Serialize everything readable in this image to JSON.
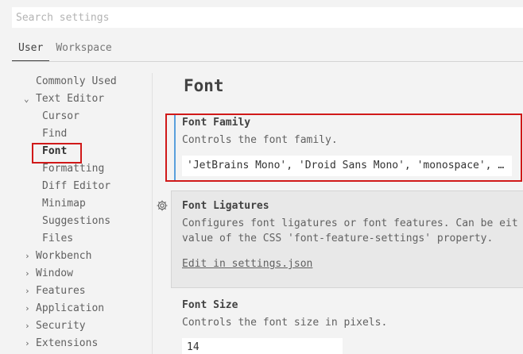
{
  "search": {
    "placeholder": "Search settings"
  },
  "tabs": [
    {
      "label": "User",
      "active": true
    },
    {
      "label": "Workspace",
      "active": false
    }
  ],
  "toc": {
    "items": [
      {
        "label": "Commonly Used",
        "chevron": ""
      },
      {
        "label": "Text Editor",
        "chevron": "chevron-down-icon"
      },
      {
        "label": "Cursor"
      },
      {
        "label": "Find"
      },
      {
        "label": "Font",
        "active": true
      },
      {
        "label": "Formatting"
      },
      {
        "label": "Diff Editor"
      },
      {
        "label": "Minimap"
      },
      {
        "label": "Suggestions"
      },
      {
        "label": "Files"
      },
      {
        "label": "Workbench",
        "chevron": "chevron-right-icon"
      },
      {
        "label": "Window",
        "chevron": "chevron-right-icon"
      },
      {
        "label": "Features",
        "chevron": "chevron-right-icon"
      },
      {
        "label": "Application",
        "chevron": "chevron-right-icon"
      },
      {
        "label": "Security",
        "chevron": "chevron-right-icon"
      },
      {
        "label": "Extensions",
        "chevron": "chevron-right-icon"
      }
    ]
  },
  "main": {
    "section_title": "Font",
    "font_family": {
      "title": "Font Family",
      "description": "Controls the font family.",
      "value": "'JetBrains Mono', 'Droid Sans Mono', 'monospace', …"
    },
    "font_ligatures": {
      "title": "Font Ligatures",
      "description_line1": "Configures font ligatures or font features. Can be eit",
      "description_line2": "value of the CSS 'font-feature-settings' property.",
      "link": "Edit in settings.json"
    },
    "font_size": {
      "title": "Font Size",
      "description": "Controls the font size in pixels.",
      "value": "14"
    }
  },
  "colors": {
    "highlight_box": "#d01919",
    "focus_bar": "#5aa0dc",
    "hover_bg": "#e8e8e8"
  }
}
